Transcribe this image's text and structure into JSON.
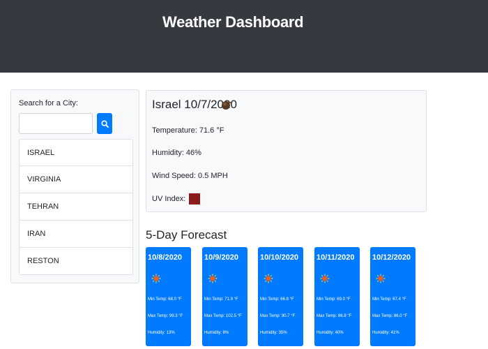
{
  "header": {
    "title": "Weather Dashboard"
  },
  "search": {
    "label": "Search for a City:",
    "value": "",
    "placeholder": ""
  },
  "cities": [
    "ISRAEL",
    "VIRGINIA",
    "TEHRAN",
    "IRAN",
    "RESTON"
  ],
  "current": {
    "title": "Israel 10/7/2020",
    "icon": "few-clouds-night-icon",
    "temperature": "Temperature: 71.6 °F",
    "humidity": "Humidity: 46%",
    "wind": "Wind Speed: 0.5 MPH",
    "uv_label": "UV Index:",
    "uv_value": "",
    "uv_color": "#8b1a1a"
  },
  "forecast": {
    "title": "5-Day Forecast",
    "days": [
      {
        "date": "10/8/2020",
        "icon": "sun-icon",
        "min": "Min Temp: 68.0 °F",
        "max": "Max Temp: 99.3 °F",
        "humidity": "Humidity: 13%"
      },
      {
        "date": "10/9/2020",
        "icon": "sun-icon",
        "min": "Min Temp: 71.9 °F",
        "max": "Max Temp: 102.5 °F",
        "humidity": "Humidity: 8%"
      },
      {
        "date": "10/10/2020",
        "icon": "sun-icon",
        "min": "Min Temp: 66.8 °F",
        "max": "Max Temp: 90.7 °F",
        "humidity": "Humidity: 35%"
      },
      {
        "date": "10/11/2020",
        "icon": "sun-icon",
        "min": "Min Temp: 69.0 °F",
        "max": "Max Temp: 86.9 °F",
        "humidity": "Humidity: 40%"
      },
      {
        "date": "10/12/2020",
        "icon": "sun-icon",
        "min": "Min Temp: 67.4 °F",
        "max": "Max Temp: 86.0 °F",
        "humidity": "Humidity: 41%"
      }
    ]
  },
  "colors": {
    "header_bg": "#343a40",
    "accent": "#007bff",
    "panel_bg": "#f8f9fa"
  }
}
